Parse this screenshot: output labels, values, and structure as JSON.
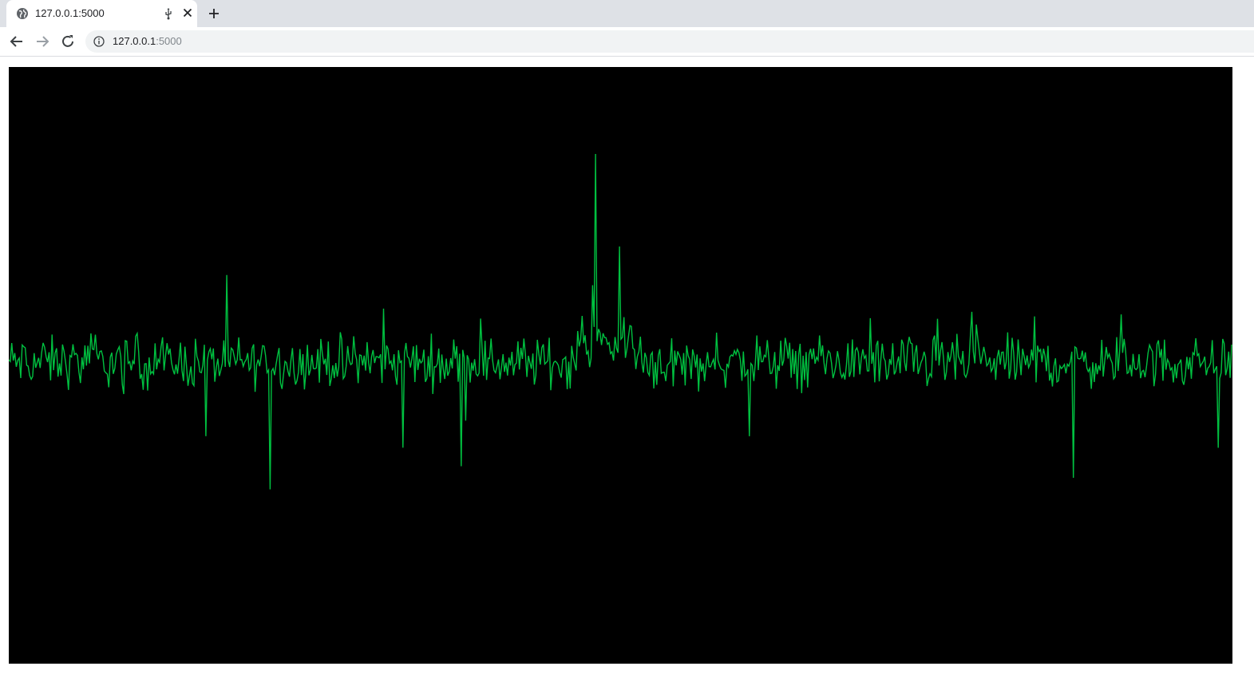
{
  "browser": {
    "tab": {
      "title": "127.0.0.1:5000",
      "favicon": "globe-icon",
      "audio_indicator": "audio-usb-icon",
      "close": "close-icon"
    },
    "new_tab": "plus-icon",
    "toolbar": {
      "back": "arrow-left-icon",
      "forward": "arrow-right-icon",
      "reload": "reload-icon",
      "site_info": "info-icon"
    },
    "address": {
      "host": "127.0.0.1",
      "port_suffix": ":5000"
    }
  },
  "page": {
    "background": "#000000",
    "signal_color": "#00c040"
  },
  "chart_data": {
    "type": "line",
    "grid": false,
    "points": 820,
    "ylim": [
      -1,
      1
    ],
    "series": [
      {
        "peaks": [
          {
            "index": 393,
            "value": 0.82
          },
          {
            "index": 409,
            "value": 0.42
          },
          {
            "index": 175,
            "value": -0.55
          },
          {
            "index": 303,
            "value": -0.45
          },
          {
            "index": 713,
            "value": -0.5
          },
          {
            "index": 496,
            "value": -0.32
          },
          {
            "index": 264,
            "value": -0.37
          },
          {
            "index": 810,
            "value": -0.37
          },
          {
            "index": 132,
            "value": -0.32
          }
        ]
      }
    ]
  }
}
